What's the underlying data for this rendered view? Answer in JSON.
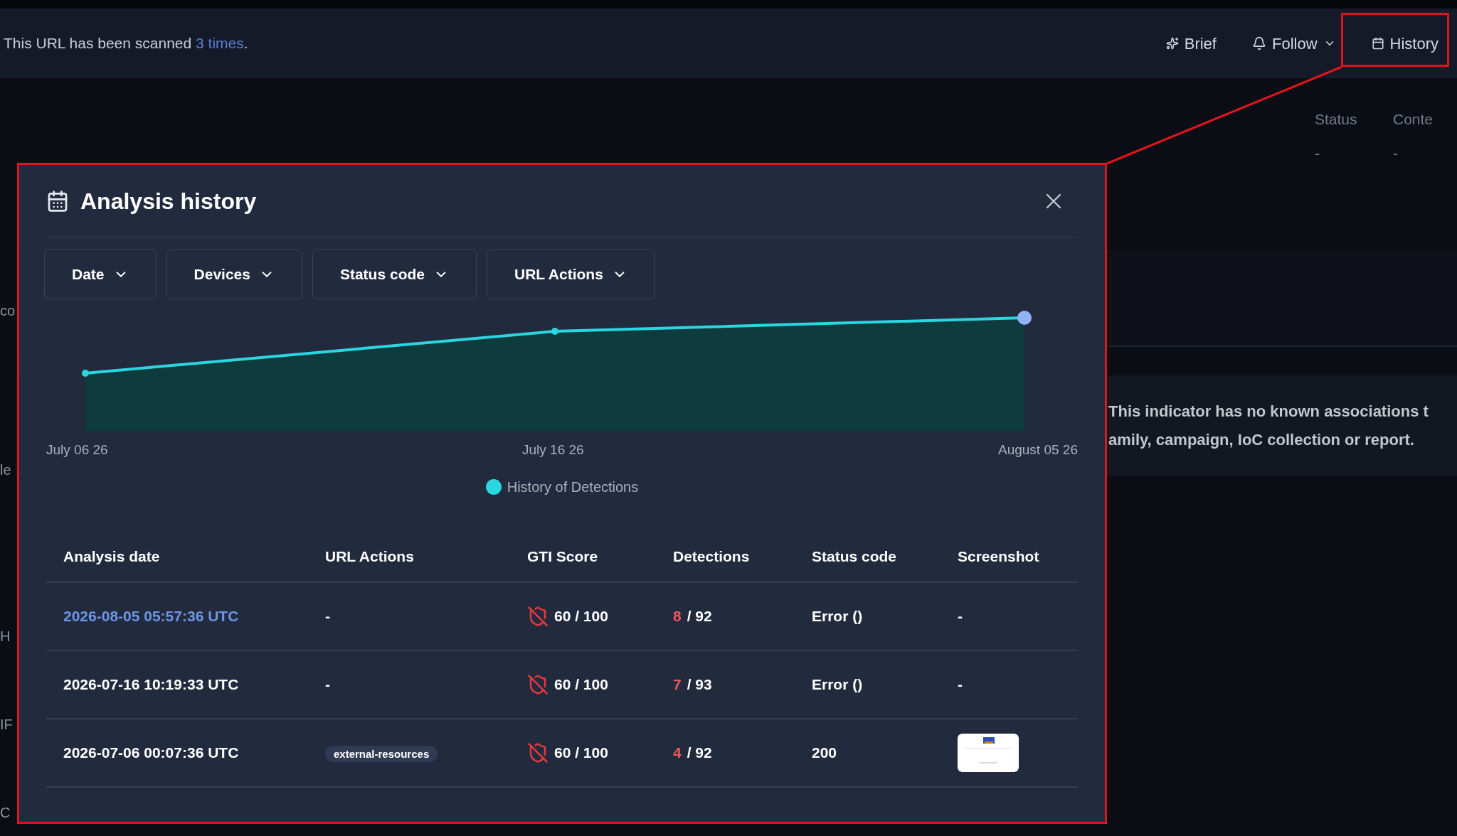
{
  "top_bar": {
    "scan_text": "This URL has been scanned",
    "scan_link": "3 times",
    "scan_end": ".",
    "actions": [
      {
        "label": "Brief",
        "kind": "brief"
      },
      {
        "label": "Follow",
        "kind": "follow"
      },
      {
        "label": "History",
        "kind": "history"
      }
    ]
  },
  "side_columns": [
    {
      "heading": "Status",
      "value": "-"
    },
    {
      "heading": "Conte",
      "value": "-"
    }
  ],
  "left_fragments": [
    "co",
    "le",
    "H",
    "IF",
    "C"
  ],
  "associations_note": [
    "This indicator has no known associations t",
    "amily, campaign, IoC collection or report."
  ],
  "modal": {
    "title": "Analysis history",
    "filters": [
      "Date",
      "Devices",
      "Status code",
      "URL Actions"
    ],
    "chart": {
      "x_labels": [
        "July 06 26",
        "July 16 26",
        "August 05 26"
      ],
      "legend": "History of Detections"
    },
    "table": {
      "columns": [
        "Analysis date",
        "URL Actions",
        "GTI Score",
        "Detections",
        "Status code",
        "Screenshot"
      ],
      "rows": [
        {
          "date": "2026-08-05 05:57:36 UTC",
          "date_link": true,
          "url_action": {
            "kind": "text",
            "text": "-"
          },
          "gti": "60 / 100",
          "detections_count": "8",
          "detections_total": "/ 92",
          "status": "Error ()",
          "screenshot": {
            "kind": "text",
            "text": "-"
          }
        },
        {
          "date": "2026-07-16 10:19:33 UTC",
          "date_link": false,
          "url_action": {
            "kind": "text",
            "text": "-"
          },
          "gti": "60 / 100",
          "detections_count": "7",
          "detections_total": "/ 93",
          "status": "Error ()",
          "screenshot": {
            "kind": "text",
            "text": "-"
          }
        },
        {
          "date": "2026-07-06 00:07:36 UTC",
          "date_link": false,
          "url_action": {
            "kind": "tag",
            "text": "external-resources"
          },
          "gti": "60 / 100",
          "detections_count": "4",
          "detections_total": "/ 92",
          "status": "200"
        }
      ]
    }
  }
}
